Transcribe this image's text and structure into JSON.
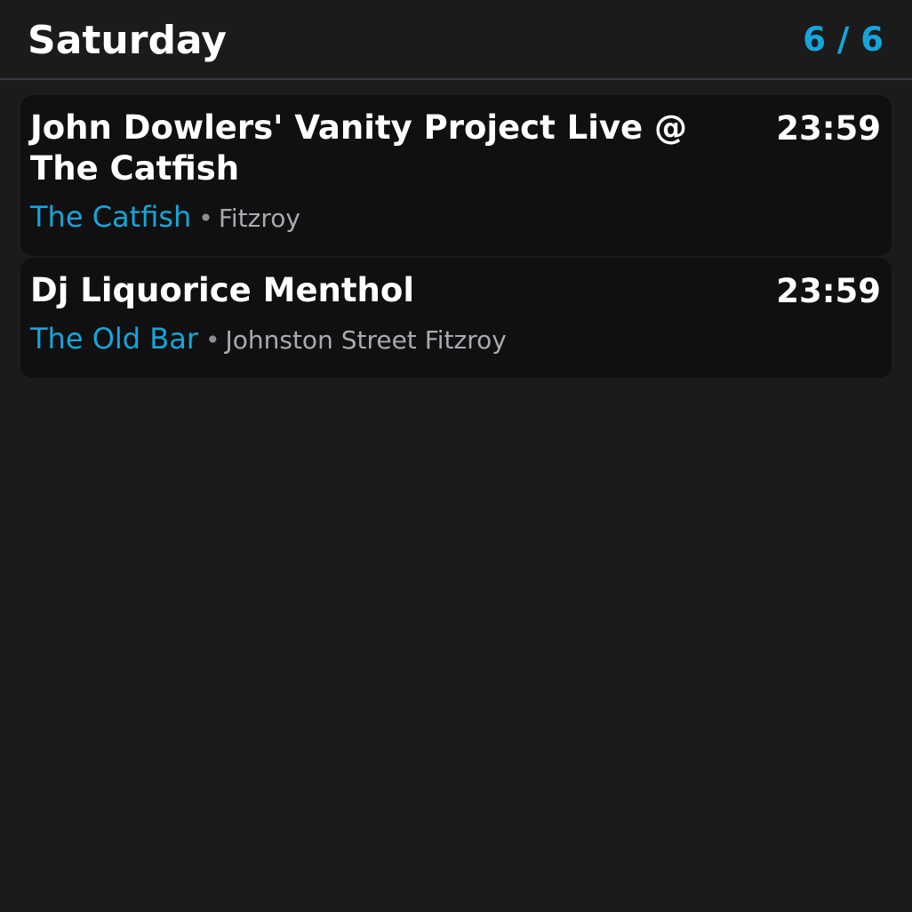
{
  "header": {
    "title": "Saturday",
    "counter": "6 / 6"
  },
  "colors": {
    "accent": "#16a5d9",
    "background": "#1b1b1b",
    "card": "#101010",
    "text": "#ffffff",
    "muted": "#a7aab1"
  },
  "events": [
    {
      "title": "John Dowlers' Vanity Project Live @ The Catfish",
      "time": "23:59",
      "venue": "The Catfish",
      "separator": "•",
      "area": "Fitzroy"
    },
    {
      "title": "Dj Liquorice Menthol",
      "time": "23:59",
      "venue": "The Old Bar",
      "separator": "•",
      "area": "Johnston Street Fitzroy"
    }
  ]
}
